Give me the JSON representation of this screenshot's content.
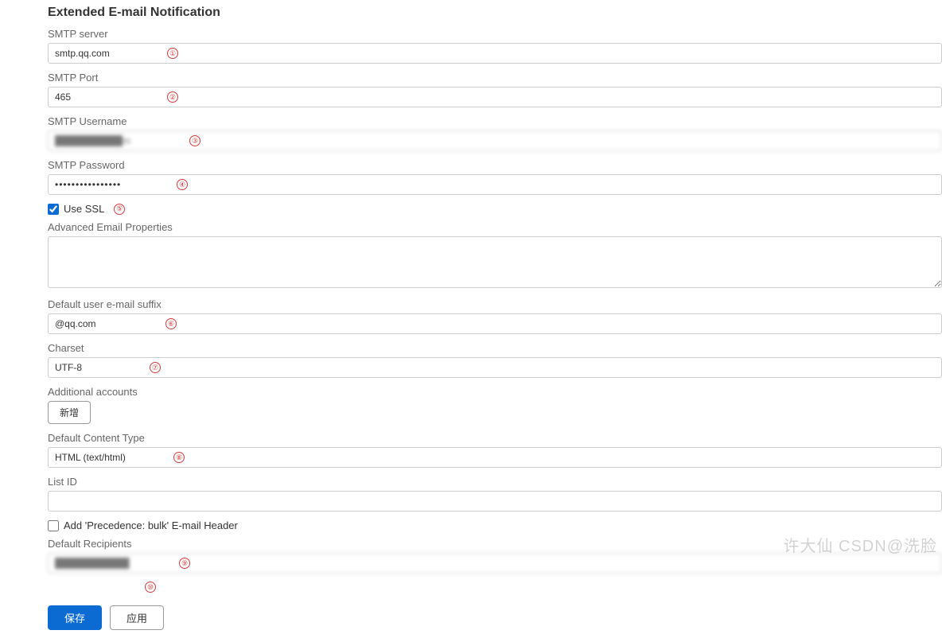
{
  "section": {
    "title": "Extended E-mail Notification"
  },
  "fields": {
    "smtp_server": {
      "label": "SMTP server",
      "value": "smtp.qq.com",
      "badge": "①"
    },
    "smtp_port": {
      "label": "SMTP Port",
      "value": "465",
      "badge": "②"
    },
    "smtp_user": {
      "label": "SMTP Username",
      "value": "██████████m",
      "badge": "③"
    },
    "smtp_pass": {
      "label": "SMTP Password",
      "value": "••••••••••••••••",
      "badge": "④"
    },
    "use_ssl": {
      "label": "Use SSL",
      "checked": true,
      "badge": "⑤"
    },
    "adv_props": {
      "label": "Advanced Email Properties",
      "value": ""
    },
    "suffix": {
      "label": "Default user e-mail suffix",
      "value": "@qq.com",
      "badge": "⑥"
    },
    "charset": {
      "label": "Charset",
      "value": "UTF-8",
      "badge": "⑦"
    },
    "additional": {
      "label": "Additional accounts",
      "add_btn": "新增"
    },
    "content_type": {
      "label": "Default Content Type",
      "value": "HTML (text/html)",
      "badge": "⑧"
    },
    "list_id": {
      "label": "List ID",
      "value": ""
    },
    "precedence": {
      "label": "Add 'Precedence: bulk' E-mail Header",
      "checked": false
    },
    "recipients": {
      "label": "Default Recipients",
      "value": "███████████",
      "badge": "⑨"
    },
    "reply_to": {
      "label": "",
      "badge": "⑩"
    }
  },
  "footer": {
    "save": "保存",
    "apply": "应用"
  },
  "watermark": "许大仙\nCSDN@洗脸"
}
